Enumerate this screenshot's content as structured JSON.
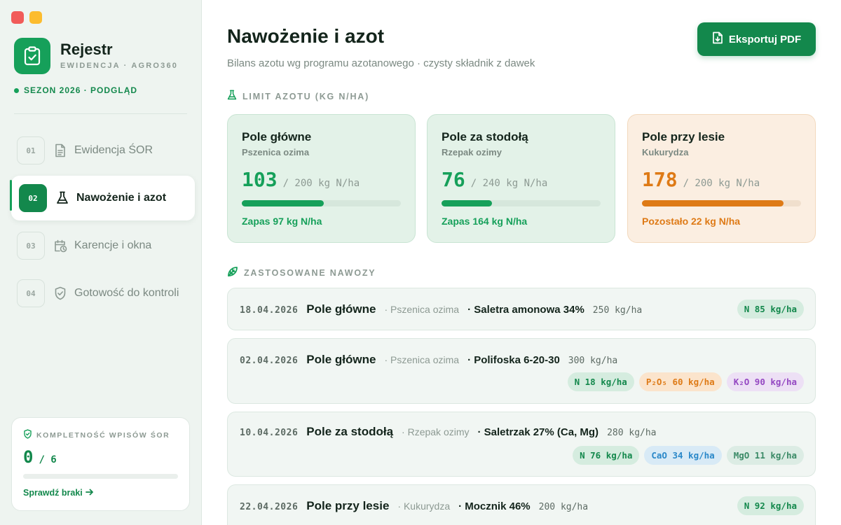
{
  "sidebar": {
    "brand": {
      "name": "Rejestr",
      "sub": "EWIDENCJA · AGRO360"
    },
    "season": "SEZON 2026 · PODGLĄD",
    "nav": [
      {
        "num": "01",
        "label": "Ewidencja ŚOR",
        "icon": "document-icon",
        "active": false
      },
      {
        "num": "02",
        "label": "Nawożenie i azot",
        "icon": "flask-icon",
        "active": true
      },
      {
        "num": "03",
        "label": "Karencje i okna",
        "icon": "calendar-clock-icon",
        "active": false
      },
      {
        "num": "04",
        "label": "Gotowość do kontroli",
        "icon": "shield-check-icon",
        "active": false
      }
    ],
    "completeness": {
      "heading": "KOMPLETNOŚĆ WPISÓW ŚOR",
      "value": "0",
      "total": "/ 6",
      "progress": 0,
      "link": "Sprawdź braki"
    }
  },
  "main": {
    "title": "Nawożenie i azot",
    "subtitle": "Bilans azotu wg programu azotanowego · czysty składnik z dawek",
    "export_label": "Eksportuj PDF",
    "limit_heading": "LIMIT AZOTU (KG N/HA)",
    "applied_heading": "ZASTOSOWANE NAWOZY",
    "fields": [
      {
        "name": "Pole główne",
        "crop": "Pszenica ozima",
        "used": "103",
        "limit": "/ 200 kg N/ha",
        "fraction": 0.515,
        "note": "Zapas 97 kg N/ha",
        "status": "ok"
      },
      {
        "name": "Pole za stodołą",
        "crop": "Rzepak ozimy",
        "used": "76",
        "limit": "/ 240 kg N/ha",
        "fraction": 0.317,
        "note": "Zapas 164 kg N/ha",
        "status": "ok"
      },
      {
        "name": "Pole przy lesie",
        "crop": "Kukurydza",
        "used": "178",
        "limit": "/ 200 kg N/ha",
        "fraction": 0.89,
        "note": "Pozostało 22 kg N/ha",
        "status": "warn"
      }
    ],
    "applications": [
      {
        "date": "18.04.2026",
        "field": "Pole główne",
        "crop": "· Pszenica ozima",
        "fertilizer": "· Saletra amonowa 34%",
        "rate": "250 kg/ha",
        "chips": [
          {
            "type": "n",
            "label": "N 85 kg/ha"
          }
        ]
      },
      {
        "date": "02.04.2026",
        "field": "Pole główne",
        "crop": "· Pszenica ozima",
        "fertilizer": "· Polifoska 6-20-30",
        "rate": "300 kg/ha",
        "chips": [
          {
            "type": "n",
            "label": "N 18 kg/ha"
          },
          {
            "type": "p",
            "label": "P₂O₅ 60 kg/ha"
          },
          {
            "type": "k",
            "label": "K₂O 90 kg/ha"
          }
        ]
      },
      {
        "date": "10.04.2026",
        "field": "Pole za stodołą",
        "crop": "· Rzepak ozimy",
        "fertilizer": "· Saletrzak 27% (Ca, Mg)",
        "rate": "280 kg/ha",
        "chips": [
          {
            "type": "n",
            "label": "N 76 kg/ha"
          },
          {
            "type": "ca",
            "label": "CaO 34 kg/ha"
          },
          {
            "type": "mg",
            "label": "MgO 11 kg/ha"
          }
        ]
      },
      {
        "date": "22.04.2026",
        "field": "Pole przy lesie",
        "crop": "· Kukurydza",
        "fertilizer": "· Mocznik 46%",
        "rate": "200 kg/ha",
        "chips": [
          {
            "type": "n",
            "label": "N 92 kg/ha"
          }
        ]
      }
    ]
  }
}
